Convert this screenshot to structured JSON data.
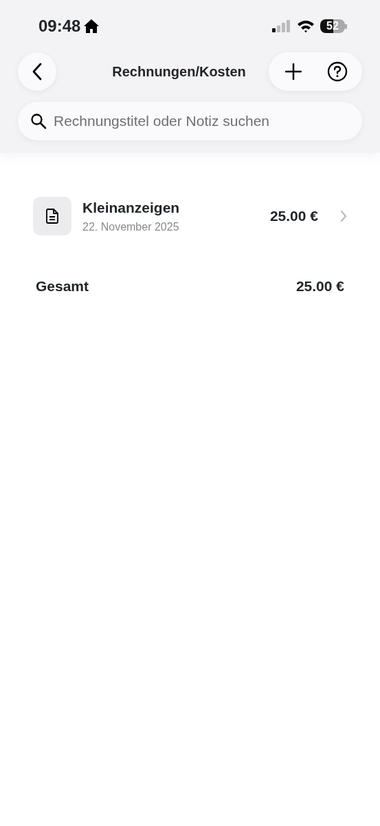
{
  "status_bar": {
    "time": "09:48",
    "battery": "52"
  },
  "header": {
    "title": "Rechnungen/Kosten"
  },
  "search": {
    "placeholder": "Rechnungstitel oder Notiz suchen"
  },
  "invoices": [
    {
      "title": "Kleinanzeigen",
      "date": "22. November 2025",
      "amount": "25.00 €"
    }
  ],
  "total": {
    "label": "Gesamt",
    "amount": "25.00 €"
  }
}
